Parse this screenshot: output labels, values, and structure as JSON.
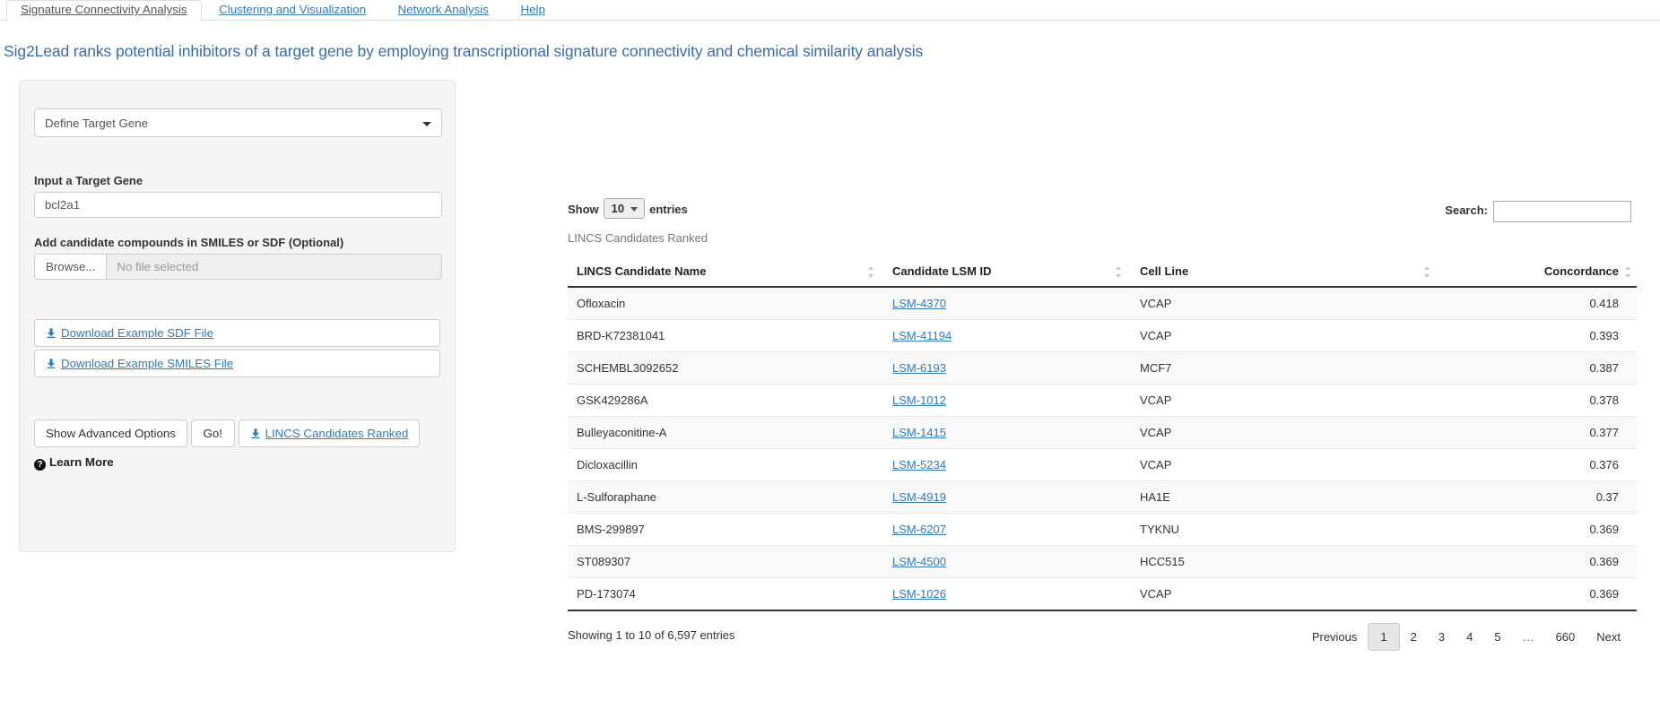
{
  "tabs": [
    {
      "label": "Signature Connectivity Analysis",
      "active": true
    },
    {
      "label": "Clustering and Visualization",
      "active": false
    },
    {
      "label": "Network Analysis",
      "active": false
    },
    {
      "label": "Help",
      "active": false
    }
  ],
  "page_title": "Sig2Lead ranks potential inhibitors of a target gene by employing transcriptional signature connectivity and chemical similarity analysis",
  "sidebar": {
    "mode_select": {
      "value": "Define Target Gene",
      "caret_icon": "chevron-down-icon"
    },
    "target_gene_label": "Input a Target Gene",
    "target_gene_value": "bcl2a1",
    "compounds_label": "Add candidate compounds in SMILES or SDF (Optional)",
    "file_browse_label": "Browse...",
    "file_status": "No file selected",
    "download_sdf_label": "Download Example SDF File",
    "download_smiles_label": "Download Example SMILES File",
    "advanced_options_label": "Show Advanced Options",
    "go_label": "Go!",
    "lincs_download_label": "LINCS Candidates Ranked",
    "learn_more_label": "Learn More",
    "download_icon": "download-icon",
    "help_icon": "question-circle-icon"
  },
  "table_controls": {
    "show_label": "Show",
    "entries_value": "10",
    "entries_label": "entries",
    "search_label": "Search:",
    "search_value": "",
    "search_placeholder": ""
  },
  "table": {
    "caption": "LINCS Candidates Ranked",
    "columns": [
      {
        "label": "LINCS Candidate Name",
        "sortable": true,
        "align": "left"
      },
      {
        "label": "Candidate LSM ID",
        "sortable": true,
        "align": "left"
      },
      {
        "label": "Cell Line",
        "sortable": true,
        "align": "left"
      },
      {
        "label": "Concordance",
        "sortable": true,
        "align": "right"
      }
    ],
    "rows": [
      {
        "name": "Ofloxacin",
        "lsm": "LSM-4370",
        "cell_line": "VCAP",
        "concordance": "0.418"
      },
      {
        "name": "BRD-K72381041",
        "lsm": "LSM-41194",
        "cell_line": "VCAP",
        "concordance": "0.393"
      },
      {
        "name": "SCHEMBL3092652",
        "lsm": "LSM-6193",
        "cell_line": "MCF7",
        "concordance": "0.387"
      },
      {
        "name": "GSK429286A",
        "lsm": "LSM-1012",
        "cell_line": "VCAP",
        "concordance": "0.378"
      },
      {
        "name": "Bulleyaconitine-A",
        "lsm": "LSM-1415",
        "cell_line": "VCAP",
        "concordance": "0.377"
      },
      {
        "name": "Dicloxacillin",
        "lsm": "LSM-5234",
        "cell_line": "VCAP",
        "concordance": "0.376"
      },
      {
        "name": "L-Sulforaphane",
        "lsm": "LSM-4919",
        "cell_line": "HA1E",
        "concordance": "0.37"
      },
      {
        "name": "BMS-299897",
        "lsm": "LSM-6207",
        "cell_line": "TYKNU",
        "concordance": "0.369"
      },
      {
        "name": "ST089307",
        "lsm": "LSM-4500",
        "cell_line": "HCC515",
        "concordance": "0.369"
      },
      {
        "name": "PD-173074",
        "lsm": "LSM-1026",
        "cell_line": "VCAP",
        "concordance": "0.369"
      }
    ]
  },
  "footer": {
    "showing": "Showing 1 to 10 of 6,597 entries",
    "pagination": [
      {
        "label": "Previous",
        "current": false
      },
      {
        "label": "1",
        "current": true
      },
      {
        "label": "2",
        "current": false
      },
      {
        "label": "3",
        "current": false
      },
      {
        "label": "4",
        "current": false
      },
      {
        "label": "5",
        "current": false
      },
      {
        "label": "…",
        "current": false,
        "ellipsis": true
      },
      {
        "label": "660",
        "current": false
      },
      {
        "label": "Next",
        "current": false
      }
    ]
  },
  "colors": {
    "link": "#337ab7",
    "title": "#3b6ca8",
    "panel_bg": "#f5f5f5",
    "row_alt": "#f9f9f9"
  }
}
